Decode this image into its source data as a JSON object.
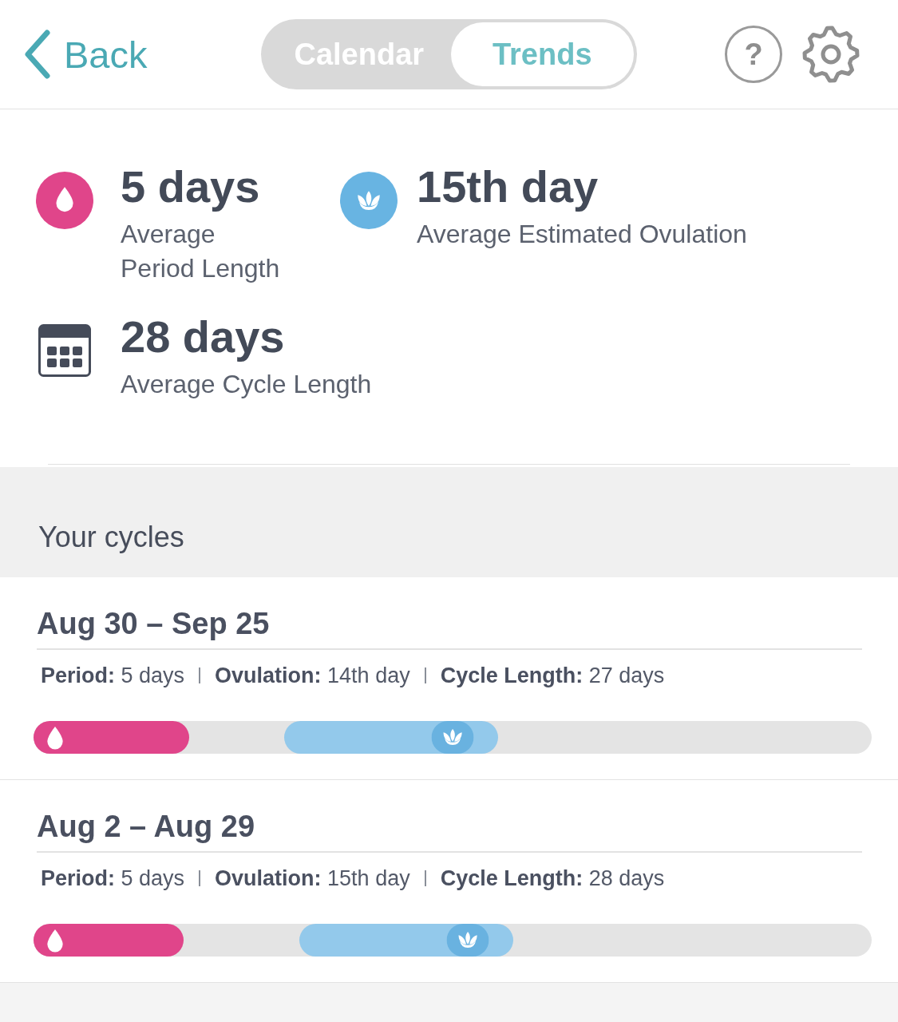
{
  "header": {
    "back": {
      "label": "Back"
    },
    "tabs": [
      {
        "label": "Calendar",
        "selected": false
      },
      {
        "label": "Trends",
        "selected": true
      }
    ],
    "help": {
      "label": "?"
    }
  },
  "summary": [
    {
      "kind": "period",
      "value": "5 days",
      "label": "Average Period Length"
    },
    {
      "kind": "ovulation",
      "value": "15th day",
      "label": "Average Estimated Ovulation"
    },
    {
      "kind": "cycle",
      "value": "28 days",
      "label": "Average Cycle Length"
    }
  ],
  "cycles_section": {
    "title": "Your cycles",
    "cycles": [
      {
        "dates": "Aug 30 – Sep 25",
        "details": [
          "**Period:** 5 days",
          "**Ovulation:** 14th day",
          "**Cycle Length:** 27 days"
        ],
        "timeline": {
          "period": {
            "level": 0.186
          },
          "ovulation": {
            "level": 0.5
          }
        }
      },
      {
        "dates": "Aug 2 – Aug 29",
        "details": [
          "**Period:** 5 days",
          "**Ovulation:** 15th day",
          "**Cycle Length:** 28 days"
        ],
        "timeline": {
          "period": {
            "level": 0.179
          },
          "ovulation": {
            "level": 0.518
          }
        }
      }
    ]
  }
}
